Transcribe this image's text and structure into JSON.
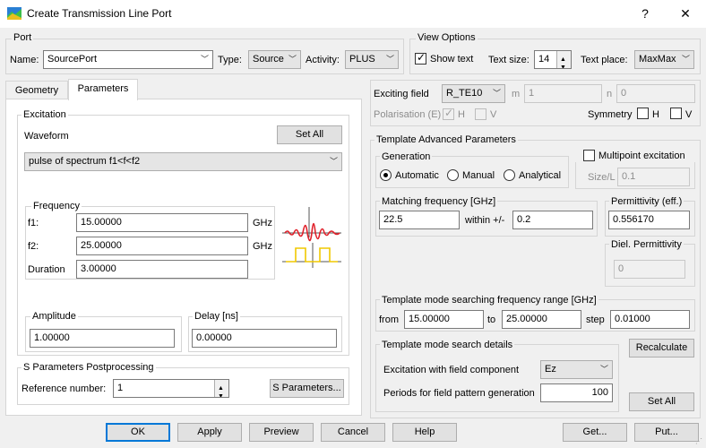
{
  "window": {
    "title": "Create Transmission Line Port",
    "help_glyph": "?",
    "close_glyph": "✕"
  },
  "port": {
    "group_label": "Port",
    "name_label": "Name:",
    "name_value": "SourcePort",
    "type_label": "Type:",
    "type_value": "Source",
    "activity_label": "Activity:",
    "activity_value": "PLUS"
  },
  "view_options": {
    "group_label": "View Options",
    "show_text_label": "Show text",
    "show_text_checked": true,
    "text_size_label": "Text size:",
    "text_size_value": "14",
    "text_place_label": "Text place:",
    "text_place_value": "MaxMax"
  },
  "tabs": [
    {
      "label": "Geometry",
      "active": false
    },
    {
      "label": "Parameters",
      "active": true
    }
  ],
  "excitation": {
    "group_label": "Excitation",
    "waveform_label": "Waveform",
    "set_all_label": "Set All",
    "waveform_value": "pulse of spectrum f1<f<f2",
    "frequency": {
      "group_label": "Frequency",
      "f1_label": "f1:",
      "f1_value": "15.00000",
      "f1_unit": "GHz",
      "f2_label": "f2:",
      "f2_value": "25.00000",
      "f2_unit": "GHz",
      "duration_label": "Duration",
      "duration_value": "3.00000"
    },
    "amplitude_label": "Amplitude",
    "amplitude_value": "1.00000",
    "delay_label": "Delay [ns]",
    "delay_value": "0.00000"
  },
  "s_params": {
    "group_label": "S Parameters Postprocessing",
    "reference_label": "Reference number:",
    "reference_value": "1",
    "button_label": "S Parameters..."
  },
  "exciting": {
    "field_label": "Exciting field",
    "field_value": "R_TE10",
    "m_label": "m",
    "m_value": "1",
    "n_label": "n",
    "n_value": "0",
    "polarisation_label": "Polarisation (E)",
    "pol_h_label": "H",
    "pol_v_label": "V",
    "symmetry_label": "Symmetry",
    "sym_h_label": "H",
    "sym_v_label": "V"
  },
  "template": {
    "group_label": "Template Advanced Parameters",
    "generation": {
      "group_label": "Generation",
      "options": [
        "Automatic",
        "Manual",
        "Analytical"
      ],
      "selected": "Automatic"
    },
    "multipoint_label": "Multipoint excitation",
    "size_l_label": "Size/L",
    "size_l_value": "0.1",
    "matching": {
      "group_label": "Matching frequency [GHz]",
      "value": "22.5",
      "within_label": "within +/-",
      "within_value": "0.2"
    },
    "permittivity": {
      "group_label": "Permittivity (eff.)",
      "value": "0.556170"
    },
    "diel": {
      "group_label": "Diel. Permittivity",
      "value": "0"
    },
    "search_range": {
      "group_label": "Template mode searching frequency range [GHz]",
      "from_label": "from",
      "from_value": "15.00000",
      "to_label": "to",
      "to_value": "25.00000",
      "step_label": "step",
      "step_value": "0.01000"
    },
    "search_details": {
      "group_label": "Template mode search details",
      "component_label": "Excitation with field component",
      "component_value": "Ez",
      "periods_label": "Periods for field pattern generation",
      "periods_value": "100"
    },
    "recalculate_label": "Recalculate",
    "set_all_label": "Set All"
  },
  "footer": {
    "ok": "OK",
    "apply": "Apply",
    "preview": "Preview",
    "cancel": "Cancel",
    "help": "Help",
    "get": "Get...",
    "put": "Put..."
  },
  "colors": {
    "accent": "#0078d7",
    "pulse_red": "#e0202a",
    "pulse_yellow": "#f0c800"
  }
}
